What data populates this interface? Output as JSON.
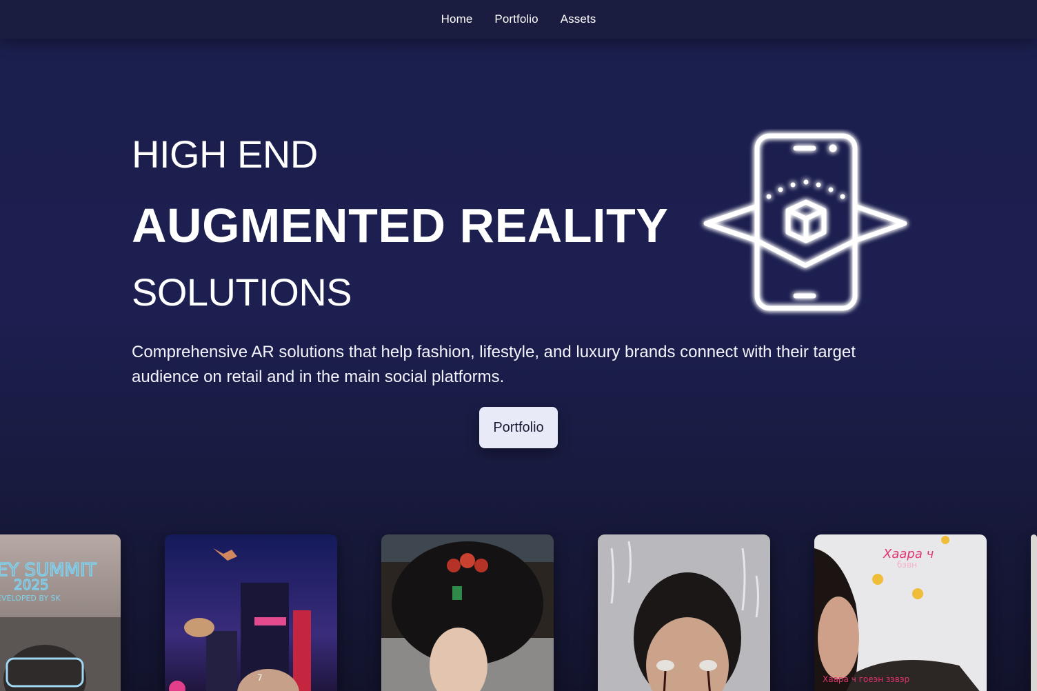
{
  "nav": {
    "items": [
      {
        "label": "Home"
      },
      {
        "label": "Portfolio"
      },
      {
        "label": "Assets"
      }
    ]
  },
  "hero": {
    "line1": "HIGH END",
    "line2": "AUGMENTED REALITY",
    "line3": "SOLUTIONS",
    "description": "Comprehensive AR solutions that help fashion, lifestyle, and luxury brands connect with their target audience on retail and in the main social platforms.",
    "cta_label": "Portfolio",
    "icon": "ar-phone-cube-icon"
  },
  "gallery": {
    "cards": [
      {
        "name": "summit-filter",
        "overlay_text_1": "EY SUMMIT",
        "overlay_text_2": "2025",
        "overlay_text_3": "EVELOPED BY  SK"
      },
      {
        "name": "night-city-filter",
        "overlay_text_1": "7"
      },
      {
        "name": "traditional-headdress-filter"
      },
      {
        "name": "ghost-eyes-filter"
      },
      {
        "name": "sweets-filter",
        "overlay_text_1": "Хаара ч",
        "overlay_text_2": "бэвн",
        "overlay_text_3": "Хаара ч гоеэн зэвэр"
      }
    ]
  },
  "colors": {
    "background": "#1c1f50",
    "nav_background": "#1a1d3f",
    "cta_background": "#e8eaf8",
    "cta_text": "#1b1d36",
    "glow": "#ffffff"
  }
}
